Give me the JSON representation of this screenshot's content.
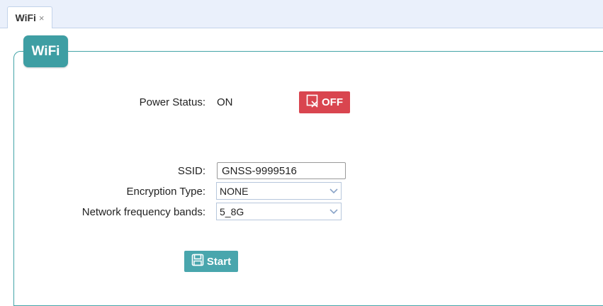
{
  "tabs": [
    {
      "label": "WiFi",
      "close": "×"
    }
  ],
  "panel": {
    "title": "WiFi"
  },
  "power": {
    "label": "Power Status:",
    "value": "ON",
    "toggle_label": "OFF",
    "toggle_color": "#d9454f"
  },
  "form": {
    "ssid_label": "SSID:",
    "ssid_value": "GNSS-9999516",
    "encryption_label": "Encryption Type:",
    "encryption_value": "NONE",
    "band_label": "Network frequency bands:",
    "band_value": "5_8G"
  },
  "actions": {
    "start_label": "Start",
    "start_color": "#49a6ad"
  },
  "colors": {
    "accent": "#3e9ea3",
    "tabbar_bg": "#eaf0fb"
  }
}
